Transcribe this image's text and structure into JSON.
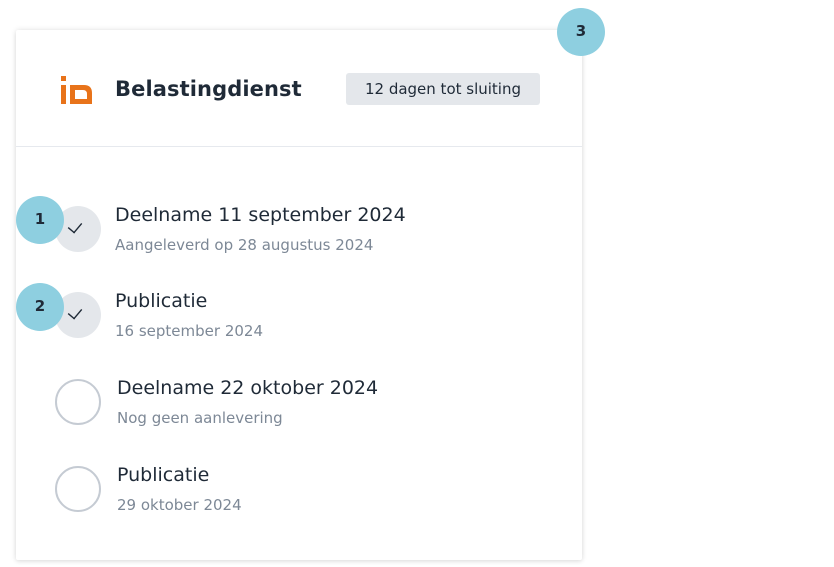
{
  "header": {
    "org_name": "Belastingdienst",
    "closing_badge": "12 dagen tot sluiting",
    "logo_icon": "belastingdienst-logo-icon",
    "logo_color": "#e8731a"
  },
  "steps": [
    {
      "title": "Deelname 11 september 2024",
      "subtitle": "Aangeleverd op 28 augustus 2024",
      "status": "done"
    },
    {
      "title": "Publicatie",
      "subtitle": "16 september 2024",
      "status": "done"
    },
    {
      "title": "Deelname 22 oktober 2024",
      "subtitle": "Nog geen aanlevering",
      "status": "todo"
    },
    {
      "title": "Publicatie",
      "subtitle": "29 oktober 2024",
      "status": "todo"
    }
  ],
  "annotations": [
    "1",
    "2",
    "3"
  ],
  "colors": {
    "annotation": "#8ecfe0",
    "badge_bg": "#e4e7eb",
    "text_primary": "#1f2a37",
    "text_secondary": "#7d8896"
  }
}
